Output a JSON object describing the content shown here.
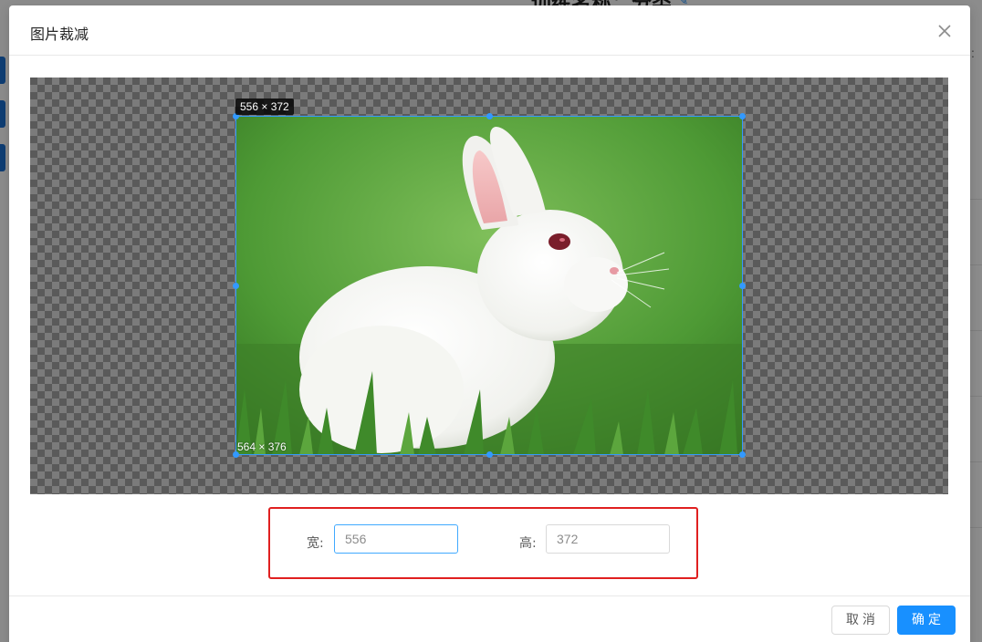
{
  "background": {
    "title": "训练名称：分类"
  },
  "dialog": {
    "title": "图片裁减",
    "close_icon": "close-icon"
  },
  "cropper": {
    "crop_size_label": "556 × 372",
    "image_size_label": "564 × 376",
    "selection_color": "#3399ff"
  },
  "form": {
    "width_label": "宽:",
    "width_value": "556",
    "height_label": "高:",
    "height_value": "372",
    "highlight_color": "#e02020"
  },
  "footer": {
    "cancel_label": "取消",
    "ok_label": "确定",
    "primary_color": "#1890ff"
  }
}
